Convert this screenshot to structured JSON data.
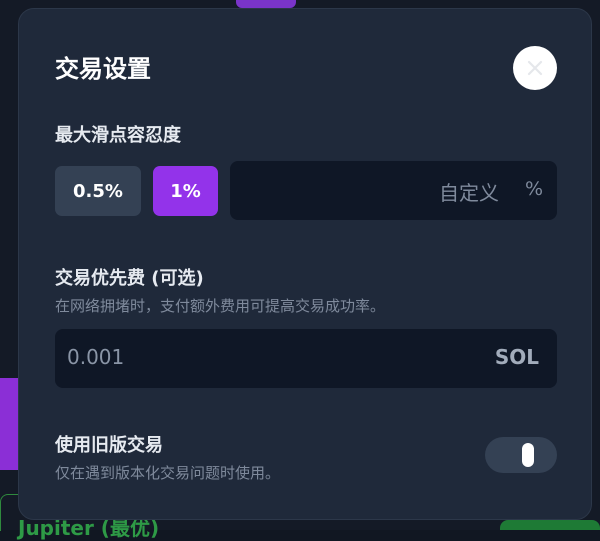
{
  "modal": {
    "title": "交易设置",
    "close_icon": "close-icon"
  },
  "slippage": {
    "label": "最大滑点容忍度",
    "options": [
      {
        "label": "0.5%",
        "selected": false
      },
      {
        "label": "1%",
        "selected": true
      }
    ],
    "custom_placeholder": "自定义",
    "custom_unit": "%"
  },
  "priority_fee": {
    "label": "交易优先费 (可选)",
    "description": "在网络拥堵时，支付额外费用可提高交易成功率。",
    "value": "0.001",
    "unit": "SOL"
  },
  "legacy": {
    "label": "使用旧版交易",
    "description": "仅在遇到版本化交易问题时使用。",
    "enabled": false
  },
  "background": {
    "partial_text": "Jupiter (最优)"
  },
  "colors": {
    "accent": "#9333ea",
    "modal_bg": "#1f293a",
    "field_bg": "#0f1726"
  }
}
